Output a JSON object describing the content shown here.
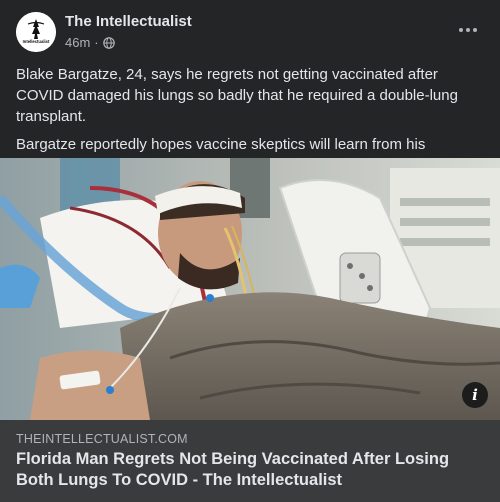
{
  "post": {
    "page_name": "The Intellectualist",
    "timestamp": "46m",
    "separator": "·",
    "audience_icon": "globe-icon",
    "avatar_text": "Intellectualist",
    "more_icon": "more-options-icon",
    "paragraphs": [
      "Blake Bargatze, 24, says he regrets not getting vaccinated after COVID damaged his lungs so badly that he required a double-lung transplant.",
      "Bargatze reportedly hopes vaccine skeptics will learn from his experience and get vaccinated."
    ]
  },
  "media": {
    "description_icon": "hospital-patient-photo",
    "info_icon": "info-icon",
    "info_glyph": "i"
  },
  "link_preview": {
    "domain": "THEINTELLECTUALIST.COM",
    "title": "Florida Man Regrets Not Being Vaccinated After Losing Both Lungs To COVID - The Intellectualist"
  },
  "colors": {
    "background": "#242526",
    "link_preview_bg": "#3a3b3c",
    "primary_text": "#e4e6eb",
    "secondary_text": "#b0b3b8"
  }
}
